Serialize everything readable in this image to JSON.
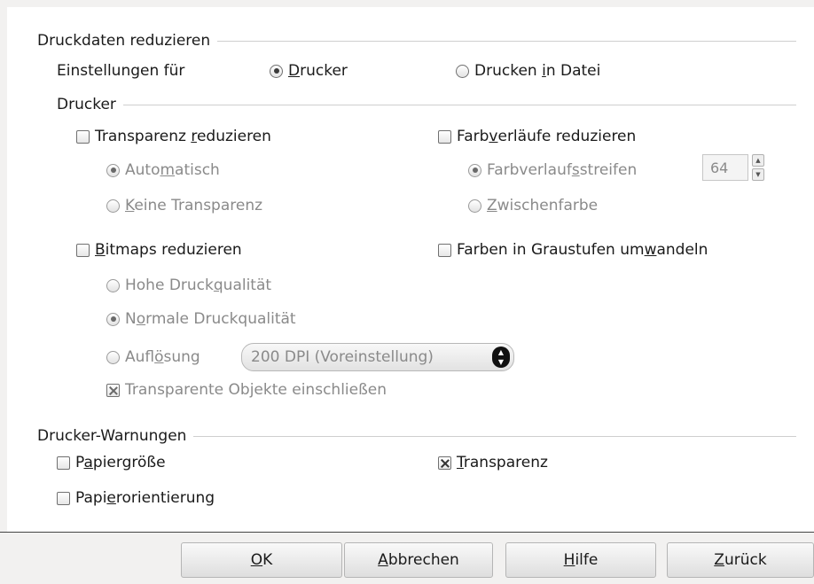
{
  "section_reduce": {
    "title": "Druckdaten reduzieren",
    "settings_for_label": "Einstellungen für",
    "printer_option": {
      "pre": "",
      "acc": "D",
      "post": "rucker",
      "checked": true
    },
    "file_option": {
      "pre": "Drucken ",
      "acc": "i",
      "post": "n Datei",
      "checked": false
    }
  },
  "printer_group": {
    "title": "Drucker",
    "transparency": {
      "label": {
        "pre": "Transparenz ",
        "acc": "r",
        "post": "eduzieren"
      },
      "checked": false,
      "auto": {
        "pre": "Auto",
        "acc": "m",
        "post": "atisch",
        "checked": true
      },
      "none": {
        "pre": "",
        "acc": "K",
        "post": "eine Transparenz",
        "checked": false
      }
    },
    "gradients": {
      "label": {
        "pre": "Farb",
        "acc": "v",
        "post": "erläufe reduzieren"
      },
      "checked": false,
      "stripes": {
        "pre": "Farbverlauf",
        "acc": "s",
        "post": "streifen",
        "checked": true
      },
      "stripes_value": "64",
      "intermediate": {
        "pre": "",
        "acc": "Z",
        "post": "wischenfarbe",
        "checked": false
      }
    },
    "bitmaps": {
      "label": {
        "pre": "",
        "acc": "B",
        "post": "itmaps reduzieren"
      },
      "checked": false,
      "high": {
        "pre": "Hohe Druck",
        "acc": "q",
        "post": "ualität",
        "checked": false
      },
      "normal": {
        "pre": "N",
        "acc": "o",
        "post": "rmale Druckqualität",
        "checked": true
      },
      "resolution": {
        "pre": "Aufl",
        "acc": "ö",
        "post": "sung",
        "checked": false
      },
      "resolution_value": "200 DPI (Voreinstellung)",
      "include_transparent": {
        "pre": "Transparente Ob",
        "acc": "j",
        "post": "ekte einschließen",
        "checked": true
      }
    },
    "grayscale": {
      "label": {
        "pre": "Farben in Graustufen um",
        "acc": "w",
        "post": "andeln"
      },
      "checked": false
    }
  },
  "warnings": {
    "title": "Drucker-Warnungen",
    "paper_size": {
      "pre": "P",
      "acc": "a",
      "post": "piergröße",
      "checked": false
    },
    "paper_orientation": {
      "pre": "Papi",
      "acc": "e",
      "post": "rorientierung",
      "checked": false
    },
    "transparency": {
      "pre": "",
      "acc": "T",
      "post": "ransparenz",
      "checked": true
    }
  },
  "buttons": {
    "ok": {
      "pre": "",
      "acc": "O",
      "post": "K"
    },
    "cancel": {
      "pre": "",
      "acc": "A",
      "post": "bbrechen"
    },
    "help": {
      "pre": "",
      "acc": "H",
      "post": "ilfe"
    },
    "back": {
      "pre": "",
      "acc": "Z",
      "post": "urück"
    }
  }
}
